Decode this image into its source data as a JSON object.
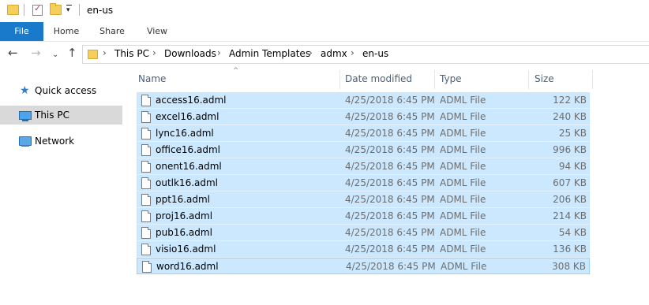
{
  "window": {
    "title": "en-us"
  },
  "ribbon": {
    "tabs": [
      "File",
      "Home",
      "Share",
      "View"
    ]
  },
  "address": {
    "crumbs": [
      "This PC",
      "Downloads",
      "Admin Templates",
      "admx",
      "en-us"
    ]
  },
  "nav": {
    "items": [
      {
        "label": "Quick access",
        "icon": "star-icon",
        "selected": false
      },
      {
        "label": "This PC",
        "icon": "computer-icon",
        "selected": true
      },
      {
        "label": "Network",
        "icon": "network-icon",
        "selected": false
      }
    ]
  },
  "list": {
    "columns": [
      "Name",
      "Date modified",
      "Type",
      "Size"
    ],
    "rows": [
      {
        "name": "access16.adml",
        "date": "4/25/2018 6:45 PM",
        "type": "ADML File",
        "size": "122 KB"
      },
      {
        "name": "excel16.adml",
        "date": "4/25/2018 6:45 PM",
        "type": "ADML File",
        "size": "240 KB"
      },
      {
        "name": "lync16.adml",
        "date": "4/25/2018 6:45 PM",
        "type": "ADML File",
        "size": "25 KB"
      },
      {
        "name": "office16.adml",
        "date": "4/25/2018 6:45 PM",
        "type": "ADML File",
        "size": "996 KB"
      },
      {
        "name": "onent16.adml",
        "date": "4/25/2018 6:45 PM",
        "type": "ADML File",
        "size": "94 KB"
      },
      {
        "name": "outlk16.adml",
        "date": "4/25/2018 6:45 PM",
        "type": "ADML File",
        "size": "607 KB"
      },
      {
        "name": "ppt16.adml",
        "date": "4/25/2018 6:45 PM",
        "type": "ADML File",
        "size": "206 KB"
      },
      {
        "name": "proj16.adml",
        "date": "4/25/2018 6:45 PM",
        "type": "ADML File",
        "size": "214 KB"
      },
      {
        "name": "pub16.adml",
        "date": "4/25/2018 6:45 PM",
        "type": "ADML File",
        "size": "54 KB"
      },
      {
        "name": "visio16.adml",
        "date": "4/25/2018 6:45 PM",
        "type": "ADML File",
        "size": "136 KB"
      },
      {
        "name": "word16.adml",
        "date": "4/25/2018 6:45 PM",
        "type": "ADML File",
        "size": "308 KB"
      }
    ]
  },
  "colors": {
    "accent": "#1979ca",
    "selection": "#cce8ff",
    "selection_border": "#99d1ff"
  }
}
